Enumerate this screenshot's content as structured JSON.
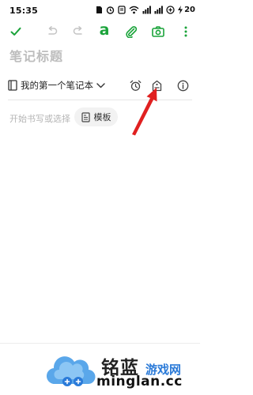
{
  "status_bar": {
    "time": "15:35",
    "battery": "20"
  },
  "toolbar": {
    "font_button_label": "a"
  },
  "editor": {
    "title_placeholder": "笔记标题",
    "notebook_name": "我的第一个笔记本",
    "body_placeholder": "开始书写或选择",
    "template_label": "模板"
  },
  "watermark": {
    "brand": "铭蓝",
    "tagline": "游戏网",
    "domain": "minglan.cc"
  },
  "colors": {
    "accent_green": "#1aa33a",
    "annotation_red": "#e02020",
    "watermark_blue": "#2a7ad8"
  }
}
